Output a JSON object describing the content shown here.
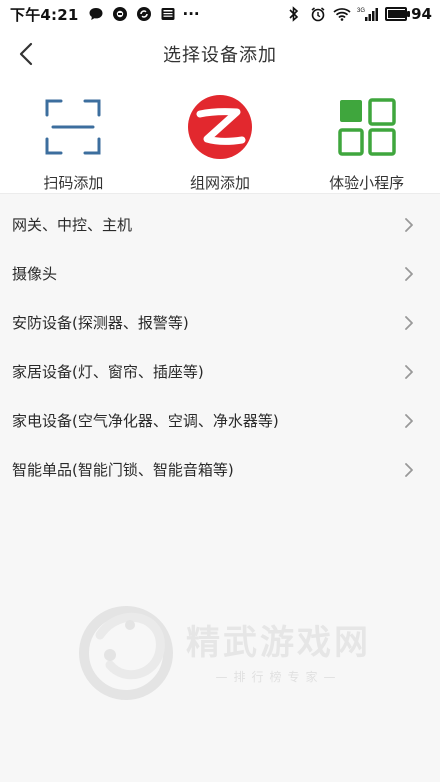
{
  "status_bar": {
    "time": "下午4:21",
    "overflow": "···",
    "battery_level": "94",
    "network": "3G",
    "icons_left": [
      "chat-bubble-icon",
      "message-app-icon",
      "sync-icon",
      "news-icon"
    ],
    "icons_right": [
      "bluetooth-icon",
      "alarm-icon",
      "wifi-icon",
      "signal-icon"
    ]
  },
  "header": {
    "title": "选择设备添加"
  },
  "quick_actions": [
    {
      "label": "扫码添加",
      "icon": "scan-frame-icon"
    },
    {
      "label": "组网添加",
      "icon": "zigbee-logo-icon",
      "color": "#e2282e"
    },
    {
      "label": "体验小程序",
      "icon": "qr-code-icon",
      "color": "#3fa63d"
    }
  ],
  "categories": [
    {
      "label": "网关、中控、主机"
    },
    {
      "label": "摄像头"
    },
    {
      "label": "安防设备(探测器、报警等)"
    },
    {
      "label": "家居设备(灯、窗帘、插座等)"
    },
    {
      "label": "家电设备(空气净化器、空调、净水器等)"
    },
    {
      "label": "智能单品(智能门锁、智能音箱等)"
    }
  ],
  "watermark": {
    "name": "精武游戏网",
    "slogan": "—排行榜专家—"
  },
  "colors": {
    "accent_blue": "#3c6e9e",
    "zigbee_red": "#e2282e",
    "qr_green": "#3fa63d"
  }
}
